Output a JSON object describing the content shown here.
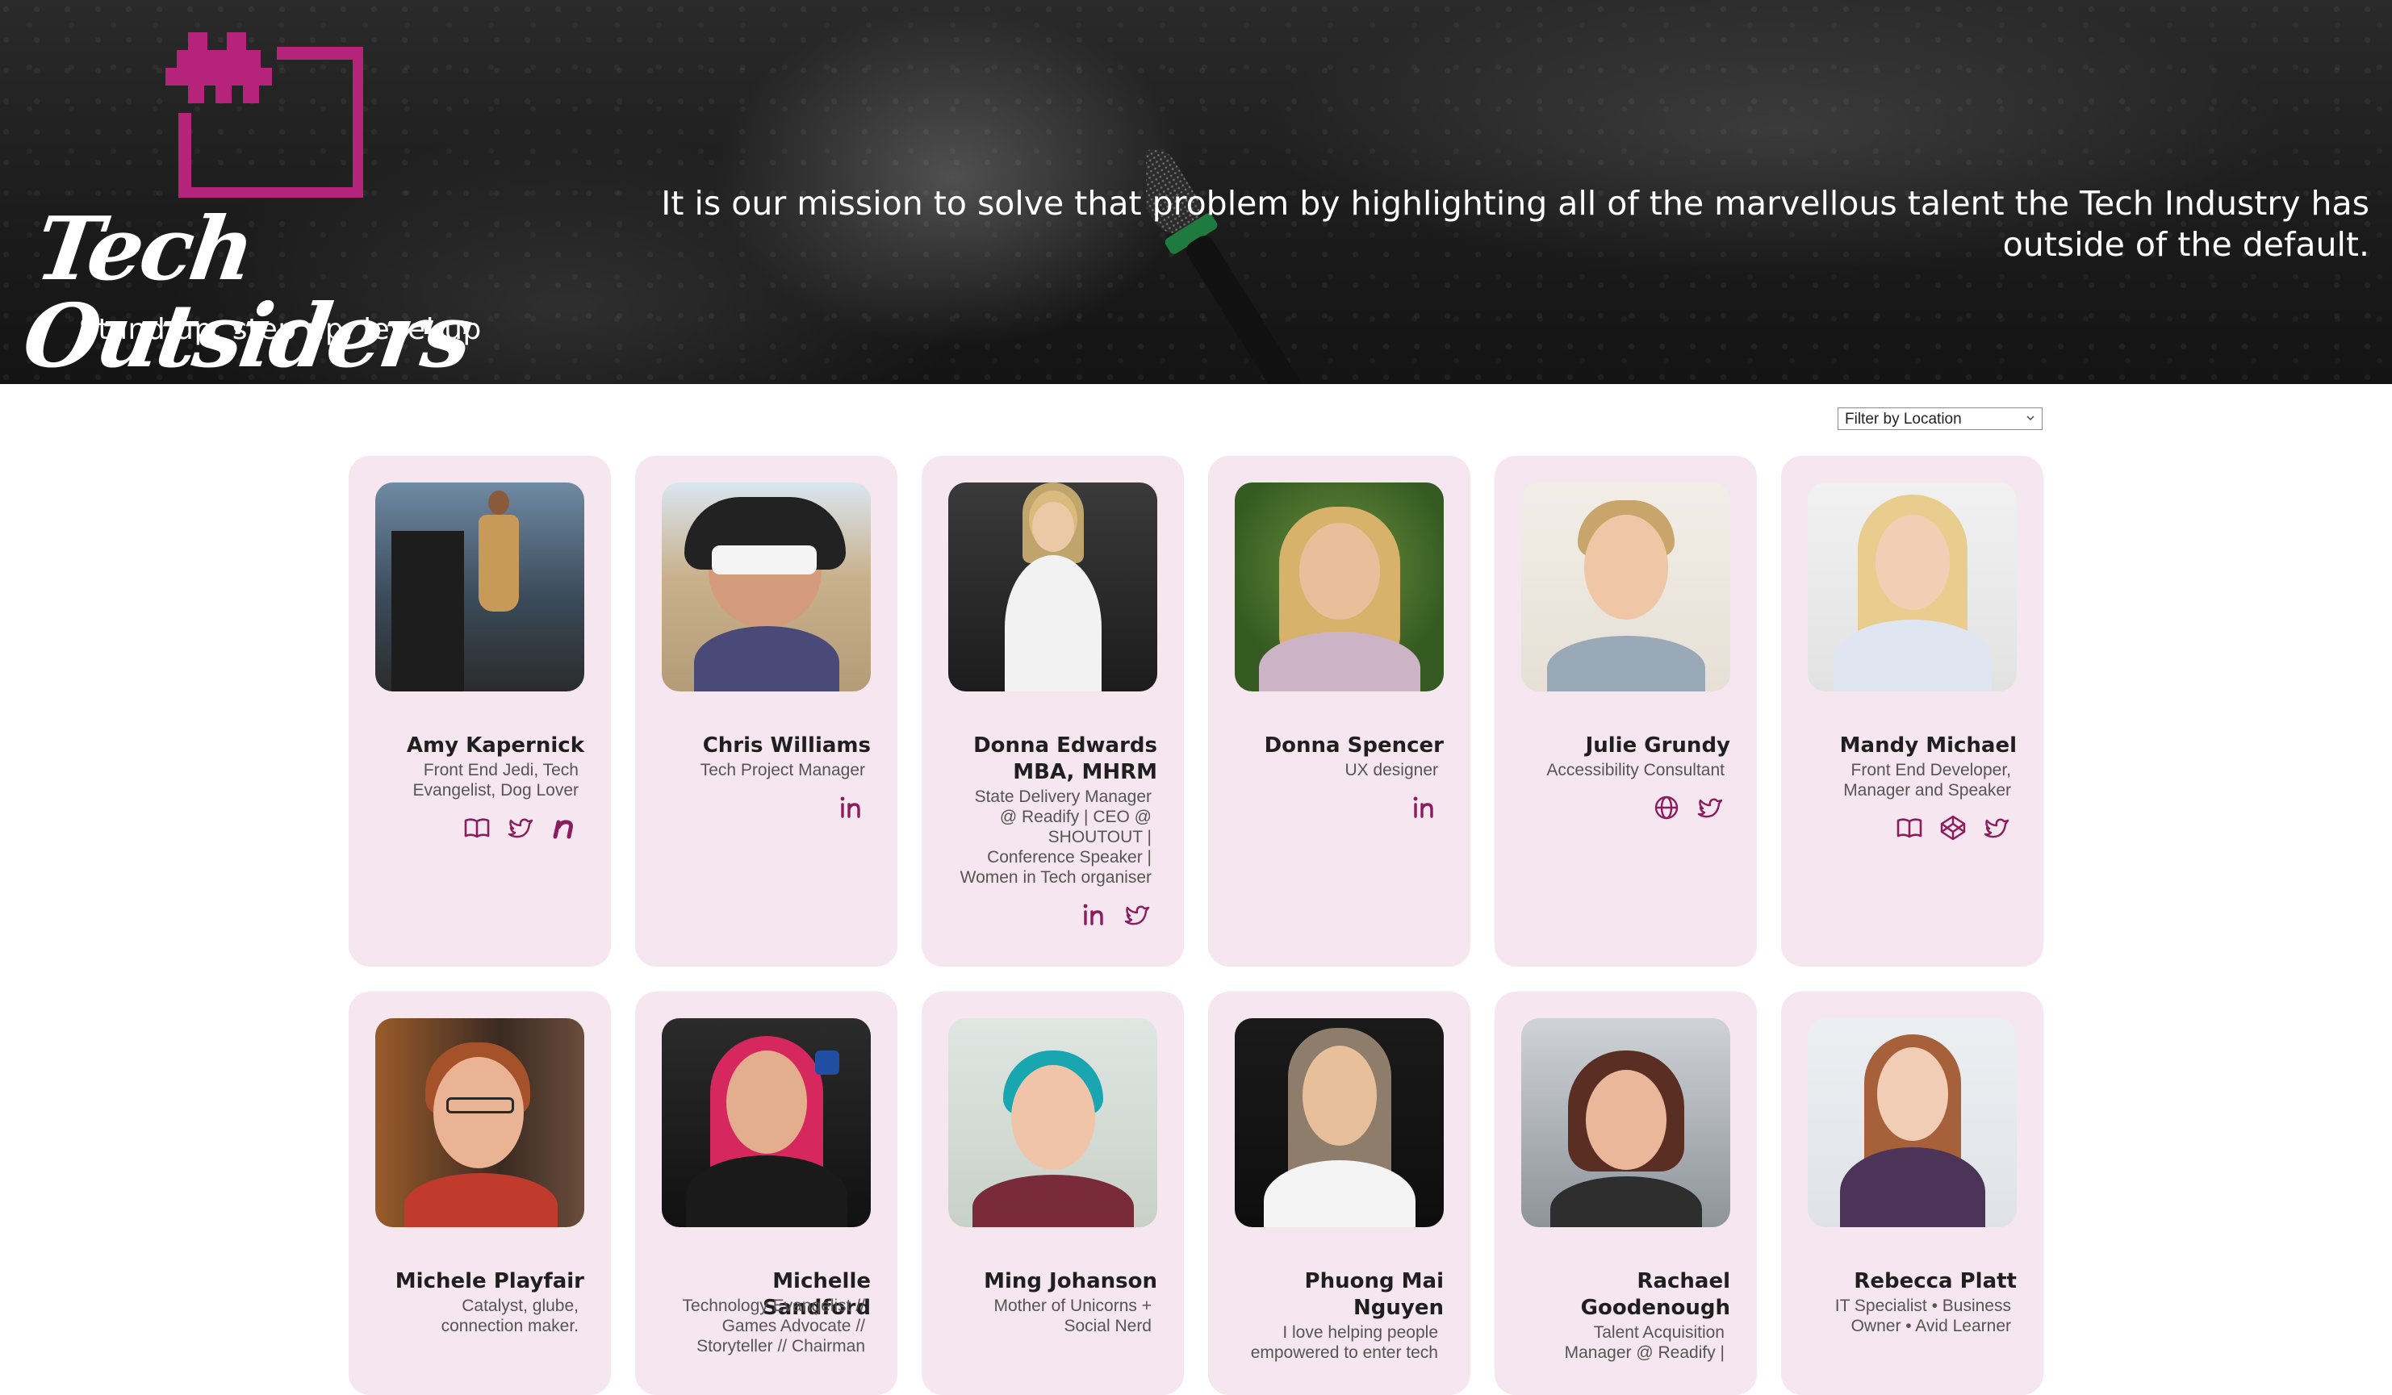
{
  "brand": {
    "title": "Tech Outsiders",
    "tagline": "Stand up, step up, level up",
    "accent": "#b5237b"
  },
  "mission": "It is our mission to solve that problem by highlighting all of the marvellous talent the Tech Industry has outside of the default.",
  "filter": {
    "selected": "Filter by Location"
  },
  "people": [
    {
      "name": "Amy Kapernick",
      "role": "Front End Jedi, Tech Evangelist, Dog Lover",
      "links": [
        "book-icon",
        "twitter-icon",
        "notist-icon"
      ]
    },
    {
      "name": "Chris Williams",
      "role": "Tech Project Manager",
      "links": [
        "linkedin-icon"
      ]
    },
    {
      "name": "Donna Edwards MBA, MHRM",
      "role": "State Delivery Manager @ Readify | CEO @ SHOUTOUT | Conference Speaker | Women in Tech organiser",
      "links": [
        "linkedin-icon",
        "twitter-icon"
      ]
    },
    {
      "name": "Donna Spencer",
      "role": "UX designer",
      "links": [
        "linkedin-icon"
      ]
    },
    {
      "name": "Julie Grundy",
      "role": "Accessibility Consultant",
      "links": [
        "globe-icon",
        "twitter-icon"
      ]
    },
    {
      "name": "Mandy Michael",
      "role": "Front End Developer, Manager and Speaker",
      "links": [
        "book-icon",
        "codepen-icon",
        "twitter-icon"
      ]
    },
    {
      "name": "Michele Playfair",
      "role": "Catalyst, glube, connection maker.",
      "links": []
    },
    {
      "name": "Michelle Sandford",
      "role": "Technology Evangelist // Games Advocate // Storyteller // Chairman",
      "links": []
    },
    {
      "name": "Ming Johanson",
      "role": "Mother of Unicorns + Social Nerd",
      "links": []
    },
    {
      "name": "Phuong Mai Nguyen",
      "role": "I love helping people empowered to enter tech",
      "links": []
    },
    {
      "name": "Rachael Goodenough",
      "role": "Talent Acquisition Manager @ Readify |",
      "links": []
    },
    {
      "name": "Rebecca Platt",
      "role": "IT Specialist • Business Owner • Avid Learner",
      "links": []
    }
  ]
}
